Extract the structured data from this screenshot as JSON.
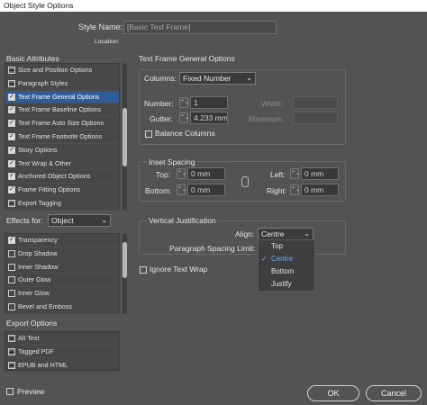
{
  "window": {
    "title": "Object Style Options"
  },
  "header": {
    "style_name_label": "Style Name:",
    "style_name_value": "[Basic Text Frame]",
    "location_label": "Location:"
  },
  "basic_attributes": {
    "title": "Basic Attributes",
    "items": [
      {
        "label": "Size and Position Options",
        "checked": "partial"
      },
      {
        "label": "Paragraph Styles",
        "checked": "partial"
      },
      {
        "label": "Text Frame General Options",
        "checked": "on",
        "selected": true
      },
      {
        "label": "Text Frame Baseline Options",
        "checked": "on"
      },
      {
        "label": "Text Frame Auto Size Options",
        "checked": "on"
      },
      {
        "label": "Text Frame Footnote Options",
        "checked": "on"
      },
      {
        "label": "Story Options",
        "checked": "on"
      },
      {
        "label": "Text Wrap & Other",
        "checked": "on"
      },
      {
        "label": "Anchored Object Options",
        "checked": "on"
      },
      {
        "label": "Frame Fitting Options",
        "checked": "on"
      },
      {
        "label": "Export Tagging",
        "checked": "partial"
      }
    ]
  },
  "effects": {
    "label": "Effects for:",
    "target": "Object",
    "items": [
      {
        "label": "Transparency",
        "checked": "on"
      },
      {
        "label": "Drop Shadow",
        "checked": "off"
      },
      {
        "label": "Inner Shadow",
        "checked": "off"
      },
      {
        "label": "Outer Glow",
        "checked": "off"
      },
      {
        "label": "Inner Glow",
        "checked": "off"
      },
      {
        "label": "Bevel and Emboss",
        "checked": "off"
      }
    ]
  },
  "export_options": {
    "title": "Export Options",
    "items": [
      {
        "label": "Alt Text",
        "checked": "partial"
      },
      {
        "label": "Tagged PDF",
        "checked": "partial"
      },
      {
        "label": "EPUB and HTML",
        "checked": "partial"
      }
    ]
  },
  "main": {
    "section_title": "Text Frame General Options",
    "columns": {
      "label": "Columns:",
      "value": "Fixed Number"
    },
    "number": {
      "label": "Number:",
      "value": "1"
    },
    "gutter": {
      "label": "Gutter:",
      "value": "4.233 mm"
    },
    "width": {
      "label": "Width:"
    },
    "maximum": {
      "label": "Maximum:"
    },
    "balance_columns": "Balance Columns",
    "inset": {
      "title": "Inset Spacing",
      "top_label": "Top:",
      "top": "0 mm",
      "bottom_label": "Bottom:",
      "bottom": "0 mm",
      "left_label": "Left:",
      "left": "0 mm",
      "right_label": "Right:",
      "right": "0 mm"
    },
    "vj": {
      "title": "Vertical Justification",
      "align_label": "Align:",
      "align_value": "Centre",
      "spacing_label": "Paragraph Spacing Limit:",
      "options": [
        "Top",
        "Centre",
        "Bottom",
        "Justify"
      ]
    },
    "ignore_wrap": "Ignore Text Wrap"
  },
  "footer": {
    "preview": "Preview",
    "ok": "OK",
    "cancel": "Cancel"
  },
  "colors": {
    "accent": "#2f5d9a",
    "link": "#6fa6ff",
    "bg": "#535353"
  }
}
